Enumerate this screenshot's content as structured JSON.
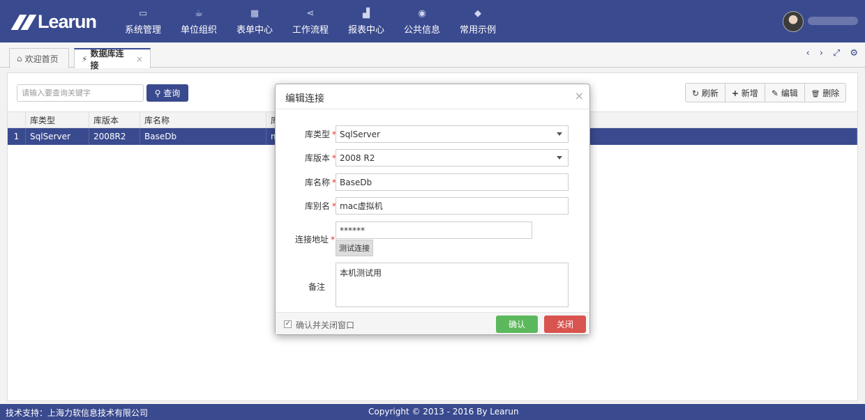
{
  "brand": {
    "logo_text": "Learun"
  },
  "nav": [
    {
      "label": "系统管理",
      "icon": "desktop-icon",
      "glyph": "▭"
    },
    {
      "label": "单位组织",
      "icon": "coffee-icon",
      "glyph": "☕"
    },
    {
      "label": "表单中心",
      "icon": "table-icon",
      "glyph": "▦"
    },
    {
      "label": "工作流程",
      "icon": "share-icon",
      "glyph": "⋖"
    },
    {
      "label": "报表中心",
      "icon": "area-chart-icon",
      "glyph": "▟"
    },
    {
      "label": "公共信息",
      "icon": "globe-icon",
      "glyph": "◉"
    },
    {
      "label": "常用示例",
      "icon": "tags-icon",
      "glyph": "◆"
    }
  ],
  "tabs": [
    {
      "label": "欢迎首页",
      "icon": "home-icon",
      "glyph": "⌂"
    },
    {
      "label": "数据库连接",
      "icon": "plug-icon",
      "glyph": "⚡",
      "close": "×"
    }
  ],
  "tab_tools": {
    "prev": "‹",
    "next": "›",
    "fullscreen": "⤢",
    "settings": "⚙"
  },
  "search": {
    "placeholder": "请输入要查询关键字",
    "button": "查询",
    "button_glyph": "⚲"
  },
  "toolbar": {
    "refresh": "刷新",
    "refresh_glyph": "↻",
    "add": "新增",
    "add_glyph": "+",
    "edit": "编辑",
    "edit_glyph": "✎",
    "delete": "删除",
    "delete_glyph": "🗑"
  },
  "grid": {
    "columns": [
      "",
      "库类型",
      "库版本",
      "库名称",
      "库"
    ],
    "rows": [
      [
        "1",
        "SqlServer",
        "2008R2",
        "BaseDb",
        "m"
      ]
    ]
  },
  "modal": {
    "title": "编辑连接",
    "close": "×",
    "fields": {
      "db_type": {
        "label": "库类型",
        "value": "SqlServer"
      },
      "db_version": {
        "label": "库版本",
        "value": "2008 R2"
      },
      "db_name": {
        "label": "库名称",
        "value": "BaseDb"
      },
      "db_alias": {
        "label": "库别名",
        "value": "mac虚拟机"
      },
      "conn": {
        "label": "连接地址",
        "value": "******",
        "test_button": "测试连接"
      },
      "remark": {
        "label": "备注",
        "value": "本机测试用"
      }
    },
    "required_mark": "*",
    "footer": {
      "checkbox_label": "确认并关闭窗口",
      "checked": true,
      "ok": "确认",
      "cancel": "关闭"
    }
  },
  "footer": {
    "support": "技术支持：上海力软信息技术有限公司",
    "copyright": "Copyright © 2013 - 2016 By Learun"
  },
  "colors": {
    "primary": "#3a4a8f",
    "success": "#5cb85c",
    "danger": "#d9534f"
  }
}
